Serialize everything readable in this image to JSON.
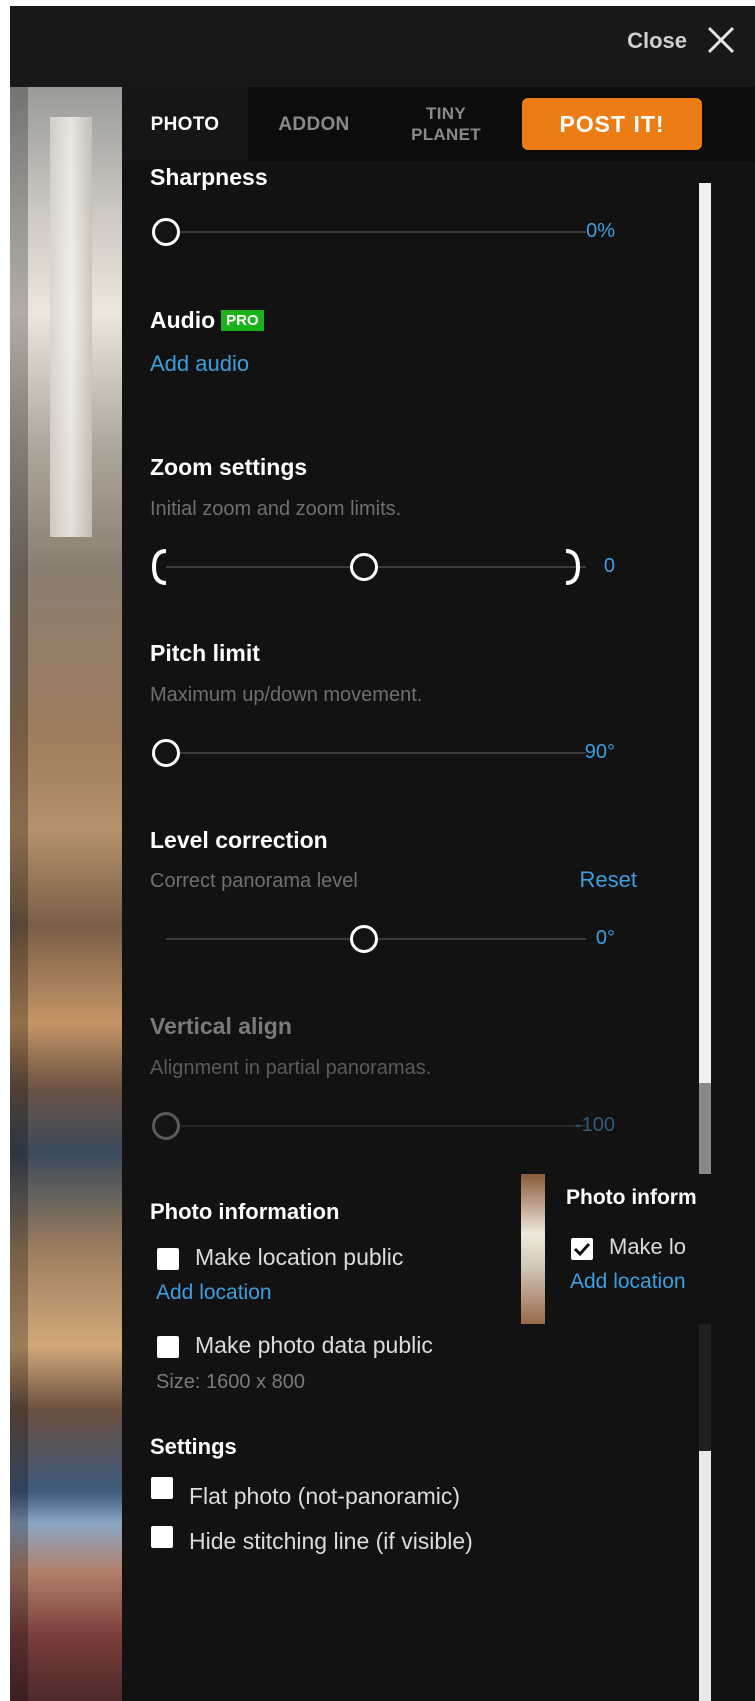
{
  "header": {
    "close_label": "Close"
  },
  "tabs": [
    {
      "label": "PHOTO",
      "active": true
    },
    {
      "label": "ADDON",
      "active": false
    },
    {
      "label": "TINY\nPLANET",
      "active": false
    }
  ],
  "post_button": {
    "label": "POST IT!",
    "color": "#ec7c14"
  },
  "sharpness": {
    "title": "Sharpness",
    "value": "0%",
    "level": 0
  },
  "audio": {
    "title": "Audio",
    "badge": "PRO",
    "link": "Add audio"
  },
  "zoom": {
    "title": "Zoom settings",
    "subtitle": "Initial zoom and zoom limits.",
    "value": "0",
    "level": 0.5
  },
  "pitch": {
    "title": "Pitch limit",
    "subtitle": "Maximum up/down movement.",
    "value": "90°",
    "level": 0
  },
  "level_correction": {
    "title": "Level correction",
    "subtitle": "Correct panorama level",
    "reset": "Reset",
    "value": "0°",
    "level": 0.5
  },
  "vertical_align": {
    "title": "Vertical align",
    "subtitle": "Alignment in partial panoramas.",
    "value": "-100",
    "level": 0
  },
  "photo_info": {
    "title": "Photo information",
    "location_label": "Make location public",
    "location_link": "Add location",
    "data_label": "Make photo data public",
    "size_text": "Size: 1600 x 800"
  },
  "settings": {
    "title": "Settings",
    "flat_label": "Flat photo (not-panoramic)",
    "stitch_label": "Hide stitching line (if visible)"
  },
  "tooltip_fragment": {
    "title": "Photo inform",
    "check_label": "Make lo",
    "link": "Add location"
  },
  "colors": {
    "accent": "#3b9fe0",
    "pro_badge": "#1bb21b",
    "panel_bg": "#121212"
  }
}
